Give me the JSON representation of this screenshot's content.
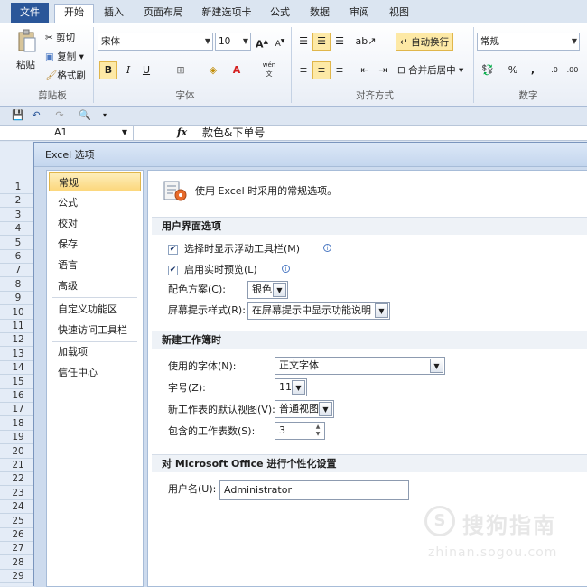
{
  "tabs": [
    {
      "label": "文件"
    },
    {
      "label": "开始"
    },
    {
      "label": "插入"
    },
    {
      "label": "页面布局"
    },
    {
      "label": "新建选项卡"
    },
    {
      "label": "公式"
    },
    {
      "label": "数据"
    },
    {
      "label": "审阅"
    },
    {
      "label": "视图"
    }
  ],
  "ribbon": {
    "clipboard": {
      "paste": "粘贴",
      "cut": "剪切",
      "copy": "复制",
      "format_painter": "格式刷",
      "label": "剪贴板"
    },
    "font": {
      "font_name": "宋体",
      "font_size": "10",
      "bold": "B",
      "italic": "I",
      "underline": "U",
      "wen": "wén",
      "label": "字体"
    },
    "alignment": {
      "wrap_text": "自动换行",
      "merge_center": "合并后居中",
      "label": "对齐方式"
    },
    "number": {
      "format": "常规",
      "percent": "%",
      "comma": ",",
      "label": "数字"
    }
  },
  "formula_bar": {
    "name_box": "A1",
    "fx": "fx",
    "content": "款色&下单号"
  },
  "rows": [
    "1",
    "2",
    "3",
    "4",
    "5",
    "6",
    "7",
    "8",
    "9",
    "10",
    "11",
    "12",
    "13",
    "14",
    "15",
    "16",
    "17",
    "18",
    "19",
    "20",
    "21",
    "22",
    "23",
    "24",
    "25",
    "26",
    "27",
    "28",
    "29"
  ],
  "dialog": {
    "title": "Excel 选项",
    "nav": [
      {
        "label": "常规"
      },
      {
        "label": "公式"
      },
      {
        "label": "校对"
      },
      {
        "label": "保存"
      },
      {
        "label": "语言"
      },
      {
        "label": "高级"
      },
      {
        "label": "自定义功能区"
      },
      {
        "label": "快速访问工具栏"
      },
      {
        "label": "加载项"
      },
      {
        "label": "信任中心"
      }
    ],
    "header": "使用 Excel 时采用的常规选项。",
    "section_ui": "用户界面选项",
    "opt_minitoolbar": "选择时显示浮动工具栏(M)",
    "opt_livepreview": "启用实时预览(L)",
    "color_scheme_label": "配色方案(C):",
    "color_scheme_value": "银色",
    "screentip_label": "屏幕提示样式(R):",
    "screentip_value": "在屏幕提示中显示功能说明",
    "section_newwb": "新建工作簿时",
    "font_label": "使用的字体(N):",
    "font_value": "正文字体",
    "size_label": "字号(Z):",
    "size_value": "11",
    "view_label": "新工作表的默认视图(V):",
    "view_value": "普通视图",
    "sheets_label": "包含的工作表数(S):",
    "sheets_value": "3",
    "section_personal": "对 Microsoft Office 进行个性化设置",
    "username_label": "用户名(U):",
    "username_value": "Administrator"
  },
  "watermark": {
    "brand": "搜狗指南",
    "url": "zhinan.sogou.com"
  }
}
